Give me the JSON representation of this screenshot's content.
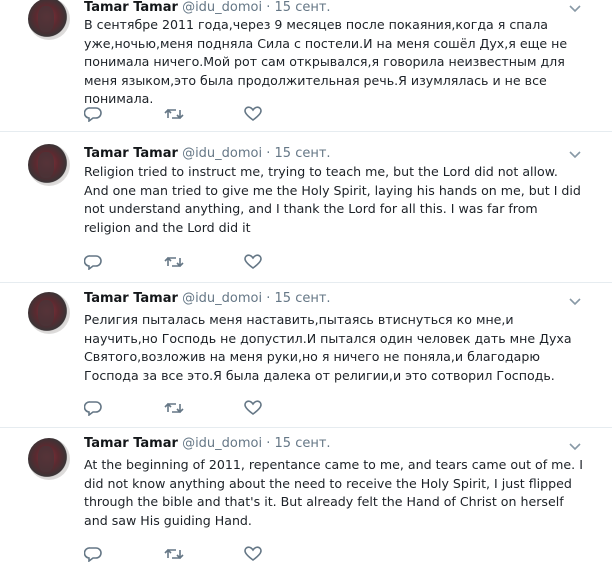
{
  "tweets": [
    {
      "name": "Tamar Tamar",
      "handle": "@idu_domoi",
      "separator": "·",
      "date": "15 сент.",
      "text": "В сентябре 2011 года,через 9 месяцев после покаяния,когда я спала уже,ночью,меня подняла Сила с постели.И на меня сошёл Дух,я еще не понимала ничего.Мой рот сам открывался,я говорила неизвестным для меня языком,это была продолжительная речь.Я изумлялась и не все понимала."
    },
    {
      "name": "Tamar Tamar",
      "handle": "@idu_domoi",
      "separator": "·",
      "date": "15 сент.",
      "text": "Religion tried to instruct me, trying to teach me, but the Lord did not allow. And one man tried to give me the Holy Spirit, laying his hands on me, but I did not understand anything, and I thank the Lord for all this. I was far from religion and the Lord did it"
    },
    {
      "name": "Tamar Tamar",
      "handle": "@idu_domoi",
      "separator": "·",
      "date": "15 сент.",
      "text": "Религия пыталась меня наставить,пытаясь втиснуться ко мне,и научить,но Господь не допустил.И пытался один человек дать мне Духа Святого,возложив на меня руки,но я ничего не поняла,и благодарю Господа за все это.Я была далека от религии,и это сотворил Господь."
    },
    {
      "name": "Tamar Tamar",
      "handle": "@idu_domoi",
      "separator": "·",
      "date": "15 сент.",
      "text": "At the beginning of 2011, repentance came to me, and tears came out of me. I did not know anything about the need to receive the Holy Spirit, I just flipped through the bible and that's it. But already felt the Hand of Christ on herself and saw His guiding Hand."
    }
  ],
  "icons": {
    "reply": "reply-icon",
    "retweet": "retweet-icon",
    "like": "like-icon",
    "menu": "chevron-down-icon"
  },
  "colors": {
    "text": "#14171a",
    "secondary": "#657786",
    "divider": "#e6ecf0",
    "icon": "#657786"
  }
}
